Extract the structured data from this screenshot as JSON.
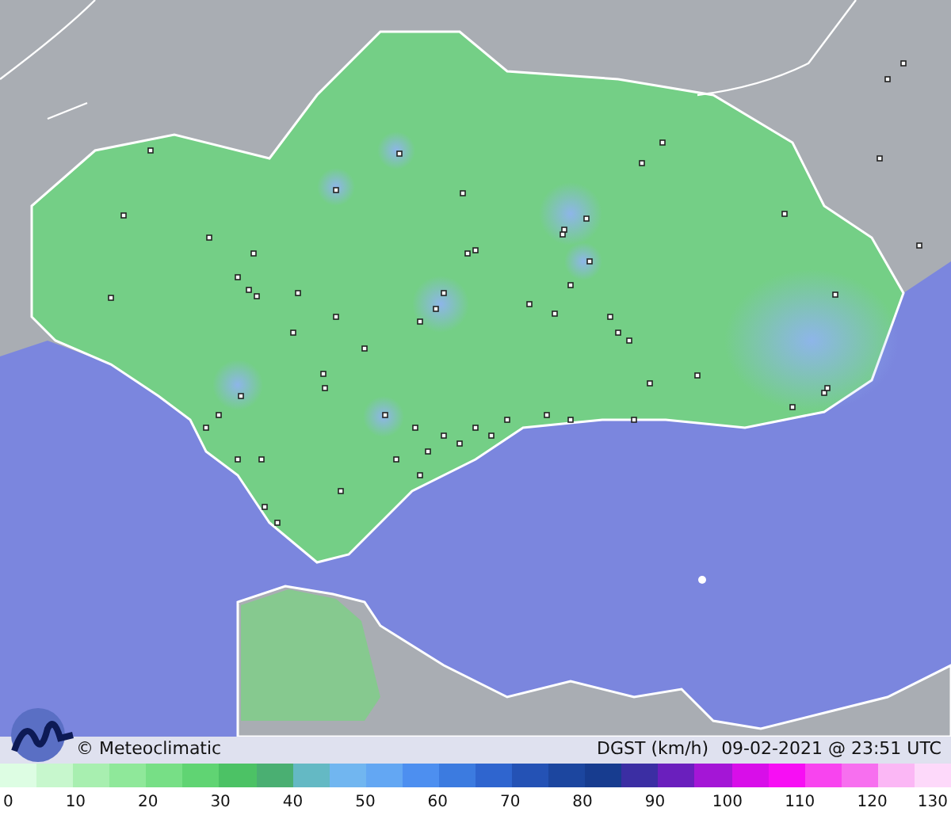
{
  "caption": {
    "credit": "© Meteoclimatic",
    "variable": "DGST (km/h)",
    "timestamp": "09-02-2021 @ 23:51 UTC"
  },
  "legend": {
    "ticks": [
      "0",
      "10",
      "20",
      "30",
      "40",
      "50",
      "60",
      "70",
      "80",
      "90",
      "100",
      "110",
      "120",
      "130"
    ]
  }
}
